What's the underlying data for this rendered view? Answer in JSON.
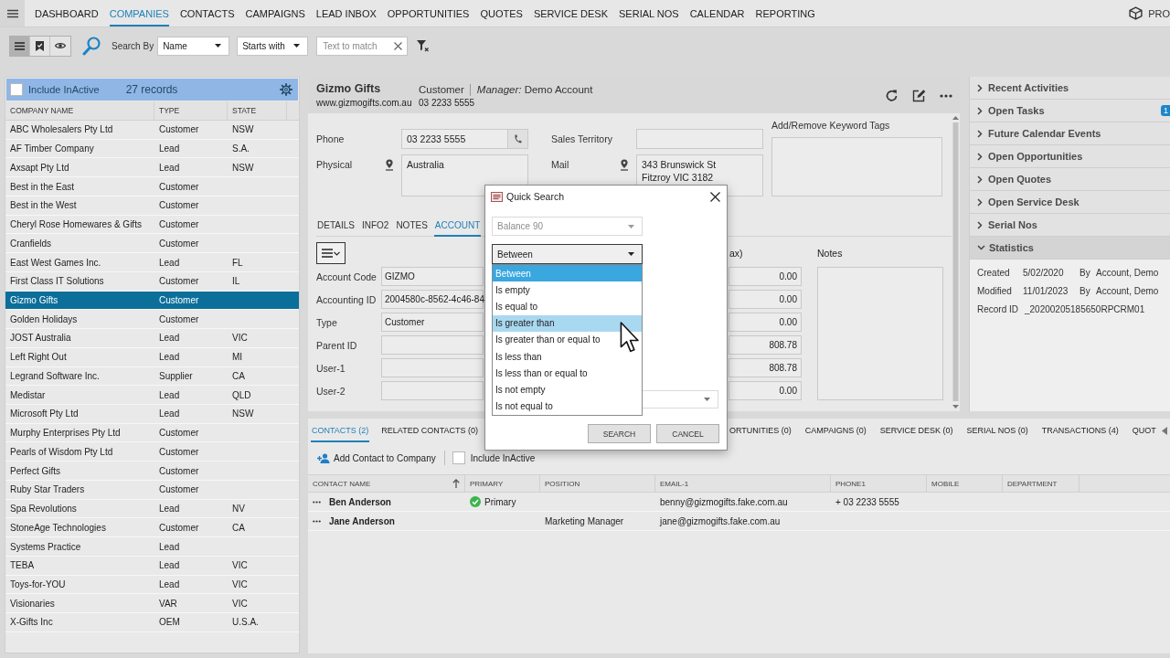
{
  "nav": {
    "items": [
      {
        "label": "DASHBOARD",
        "selected": false
      },
      {
        "label": "COMPANIES",
        "selected": true
      },
      {
        "label": "CONTACTS",
        "selected": false
      },
      {
        "label": "CAMPAIGNS",
        "selected": false
      },
      {
        "label": "LEAD INBOX",
        "selected": false
      },
      {
        "label": "OPPORTUNITIES",
        "selected": false
      },
      {
        "label": "QUOTES",
        "selected": false
      },
      {
        "label": "SERVICE DESK",
        "selected": false
      },
      {
        "label": "SERIAL NOS",
        "selected": false
      },
      {
        "label": "CALENDAR",
        "selected": false
      },
      {
        "label": "REPORTING",
        "selected": false
      }
    ],
    "brand": "PRO"
  },
  "toolbar": {
    "views": [
      {
        "kind": "list",
        "selected": true
      },
      {
        "kind": "tagged",
        "selected": false
      },
      {
        "kind": "preview",
        "selected": false
      }
    ],
    "search_by_label": "Search By",
    "search_by": "Name",
    "match_mode": "Starts with",
    "match_text": {
      "placeholder": "Text to match"
    }
  },
  "company_list": {
    "include_inactive": {
      "label": "Include InActive",
      "checked": false
    },
    "record_count": "27 records",
    "columns": [
      "COMPANY NAME",
      "TYPE",
      "STATE"
    ],
    "rows": [
      {
        "name": "ABC Wholesalers Pty Ltd",
        "type": "Customer",
        "state": "NSW",
        "selected": false
      },
      {
        "name": "AF Timber Company",
        "type": "Lead",
        "state": "S.A.",
        "selected": false
      },
      {
        "name": "Axsapt Pty Ltd",
        "type": "Lead",
        "state": "NSW",
        "selected": false
      },
      {
        "name": "Best in the East",
        "type": "Customer",
        "selected": false
      },
      {
        "name": "Best in the West",
        "type": "Customer",
        "selected": false
      },
      {
        "name": "Cheryl Rose Homewares & Gifts",
        "type": "Customer",
        "selected": false
      },
      {
        "name": "Cranfields",
        "type": "Customer",
        "selected": false
      },
      {
        "name": "East West Games Inc.",
        "type": "Lead",
        "state": "FL",
        "selected": false
      },
      {
        "name": "First Class IT Solutions",
        "type": "Customer",
        "state": "IL",
        "selected": false
      },
      {
        "name": "Gizmo Gifts",
        "type": "Customer",
        "selected": true
      },
      {
        "name": "Golden Holidays",
        "type": "Customer",
        "selected": false
      },
      {
        "name": "JOST Australia",
        "type": "Lead",
        "state": "VIC",
        "selected": false
      },
      {
        "name": "Left Right Out",
        "type": "Lead",
        "state": "MI",
        "selected": false
      },
      {
        "name": "Legrand Software Inc.",
        "type": "Supplier",
        "state": "CA",
        "selected": false
      },
      {
        "name": "Medistar",
        "type": "Lead",
        "state": "QLD",
        "selected": false
      },
      {
        "name": "Microsoft Pty Ltd",
        "type": "Lead",
        "state": "NSW",
        "selected": false
      },
      {
        "name": "Murphy Enterprises Pty Ltd",
        "type": "Customer",
        "selected": false
      },
      {
        "name": "Pearls of Wisdom Pty Ltd",
        "type": "Customer",
        "selected": false
      },
      {
        "name": "Perfect Gifts",
        "type": "Customer",
        "selected": false
      },
      {
        "name": "Ruby Star Traders",
        "type": "Customer",
        "selected": false
      },
      {
        "name": "Spa Revolutions",
        "type": "Lead",
        "state": "NV",
        "selected": false
      },
      {
        "name": "StoneAge Technologies",
        "type": "Customer",
        "state": "CA",
        "selected": false
      },
      {
        "name": "Systems Practice",
        "type": "Lead",
        "selected": false
      },
      {
        "name": "TEBA",
        "type": "Lead",
        "state": "VIC",
        "selected": false
      },
      {
        "name": "Toys-for-YOU",
        "type": "Lead",
        "state": "VIC",
        "selected": false
      },
      {
        "name": "Visionaries",
        "type": "VAR",
        "state": "VIC",
        "selected": false
      },
      {
        "name": "X-Gifts Inc",
        "type": "OEM",
        "state": "U.S.A.",
        "selected": false
      }
    ]
  },
  "company": {
    "name": "Gizmo Gifts",
    "website": "www.gizmogifts.com.au",
    "type": "Customer",
    "manager": "*Manager:* Demo Account",
    "phone": "03 2233 5555"
  },
  "contact_fields": {
    "phone": {
      "label": "Phone",
      "value": "03 2233 5555"
    },
    "sales_territory": {
      "label": "Sales Territory"
    },
    "physical": {
      "label": "Physical",
      "lines": [
        "Australia"
      ]
    },
    "mail": {
      "label": "Mail",
      "lines": [
        "343 Brunswick St",
        "Fitzroy VIC 3182"
      ]
    },
    "keyword_tags": {
      "label": "Add/Remove Keyword Tags"
    }
  },
  "detail_tabs": [
    {
      "label": "DETAILS",
      "selected": false
    },
    {
      "label": "INFO2",
      "selected": false
    },
    {
      "label": "NOTES",
      "selected": false
    },
    {
      "label": "ACCOUNT",
      "selected": true
    }
  ],
  "account": {
    "fields": [
      {
        "label": "Account Code",
        "value": "GIZMO"
      },
      {
        "label": "Accounting ID",
        "value": "2004580c-8562-4c46-84"
      },
      {
        "label": "Type",
        "value": "Customer"
      },
      {
        "label": "Parent ID"
      },
      {
        "label": "User-1"
      },
      {
        "label": "User-2"
      }
    ],
    "amounts_label": "ax)",
    "amounts": [
      "0.00",
      "0.00",
      "0.00",
      "808.78",
      "808.78",
      "0.00"
    ],
    "notes_label": "Notes"
  },
  "quick_search": {
    "title": "Quick Search",
    "field": {
      "value": "Balance 90",
      "disabled": true
    },
    "operator": {
      "value": "Between",
      "expanded": true
    },
    "options": [
      {
        "label": "Between",
        "selected": true,
        "hovered": false
      },
      {
        "label": "Is empty",
        "selected": false,
        "hovered": false
      },
      {
        "label": "Is equal to",
        "selected": false,
        "hovered": false
      },
      {
        "label": "Is greater than",
        "selected": false,
        "hovered": true
      },
      {
        "label": "Is greater than or equal to",
        "selected": false,
        "hovered": false
      },
      {
        "label": "Is less than",
        "selected": false,
        "hovered": false
      },
      {
        "label": "Is less than or equal to",
        "selected": false,
        "hovered": false
      },
      {
        "label": "Is not empty",
        "selected": false,
        "hovered": false
      },
      {
        "label": "Is not equal to",
        "selected": false,
        "hovered": false
      }
    ],
    "buttons": [
      "SEARCH",
      "CANCEL"
    ]
  },
  "related_tabs": [
    {
      "label": "CONTACTS (2)",
      "selected": true
    },
    {
      "label": "RELATED CONTACTS (0)",
      "selected": false
    },
    {
      "label": "ORTUNITIES (0)",
      "selected": false
    },
    {
      "label": "CAMPAIGNS (0)",
      "selected": false
    },
    {
      "label": "SERVICE DESK (0)",
      "selected": false
    },
    {
      "label": "SERIAL NOS (0)",
      "selected": false
    },
    {
      "label": "TRANSACTIONS (4)",
      "selected": false
    },
    {
      "label": "QUOT",
      "selected": false
    }
  ],
  "contacts": {
    "add_label": "Add Contact to Company",
    "include_inactive": {
      "label": "Include InActive",
      "checked": false
    },
    "columns": [
      {
        "label": "CONTACT NAME",
        "sorted": true
      },
      {
        "label": "PRIMARY",
        "sorted": false
      },
      {
        "label": "POSITION",
        "sorted": false
      },
      {
        "label": "EMAIL-1",
        "sorted": false
      },
      {
        "label": "PHONE1",
        "sorted": false
      },
      {
        "label": "MOBILE",
        "sorted": false
      },
      {
        "label": "DEPARTMENT",
        "sorted": false
      }
    ],
    "rows": [
      {
        "name": "Ben Anderson",
        "primary": true,
        "primary_label": "Primary",
        "email": "benny@gizmogifts.fake.com.au",
        "phone": "+ 03 2233 5555"
      },
      {
        "name": "Jane Anderson",
        "primary": false,
        "position": "Marketing Manager",
        "email": "jane@gizmogifts.fake.com.au"
      }
    ]
  },
  "side_panel": [
    {
      "label": "Recent Activities",
      "expanded": false
    },
    {
      "label": "Open Tasks",
      "expanded": false,
      "badge": "1"
    },
    {
      "label": "Future Calendar Events",
      "expanded": false
    },
    {
      "label": "Open Opportunities",
      "expanded": false
    },
    {
      "label": "Open Quotes",
      "expanded": false
    },
    {
      "label": "Open Service Desk",
      "expanded": false
    },
    {
      "label": "Serial Nos",
      "expanded": false
    },
    {
      "label": "Statistics",
      "expanded": true,
      "details": [
        {
          "label": "Created",
          "date": "5/02/2020",
          "by_label": "By",
          "by": "Account, Demo"
        },
        {
          "label": "Modified",
          "date": "11/01/2023",
          "by_label": "By",
          "by": "Account, Demo"
        },
        {
          "label": "Record ID",
          "value": "_20200205185650RPCRM01"
        }
      ]
    }
  ]
}
